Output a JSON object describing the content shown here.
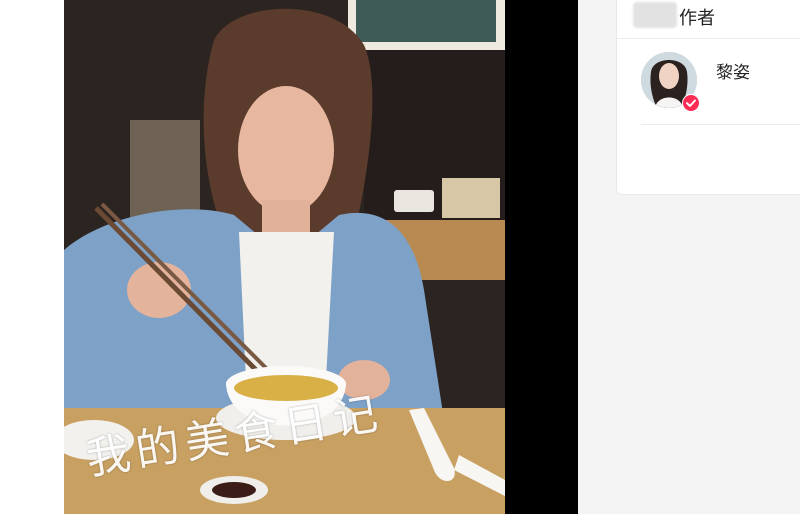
{
  "video": {
    "caption": "我的美食日记"
  },
  "author_panel": {
    "title": "作者",
    "author": {
      "name": "黎姿",
      "verified": true
    }
  },
  "colors": {
    "accent_badge": "#fe2c55",
    "panel_bg": "#ffffff",
    "page_bg": "#f4f4f4"
  }
}
